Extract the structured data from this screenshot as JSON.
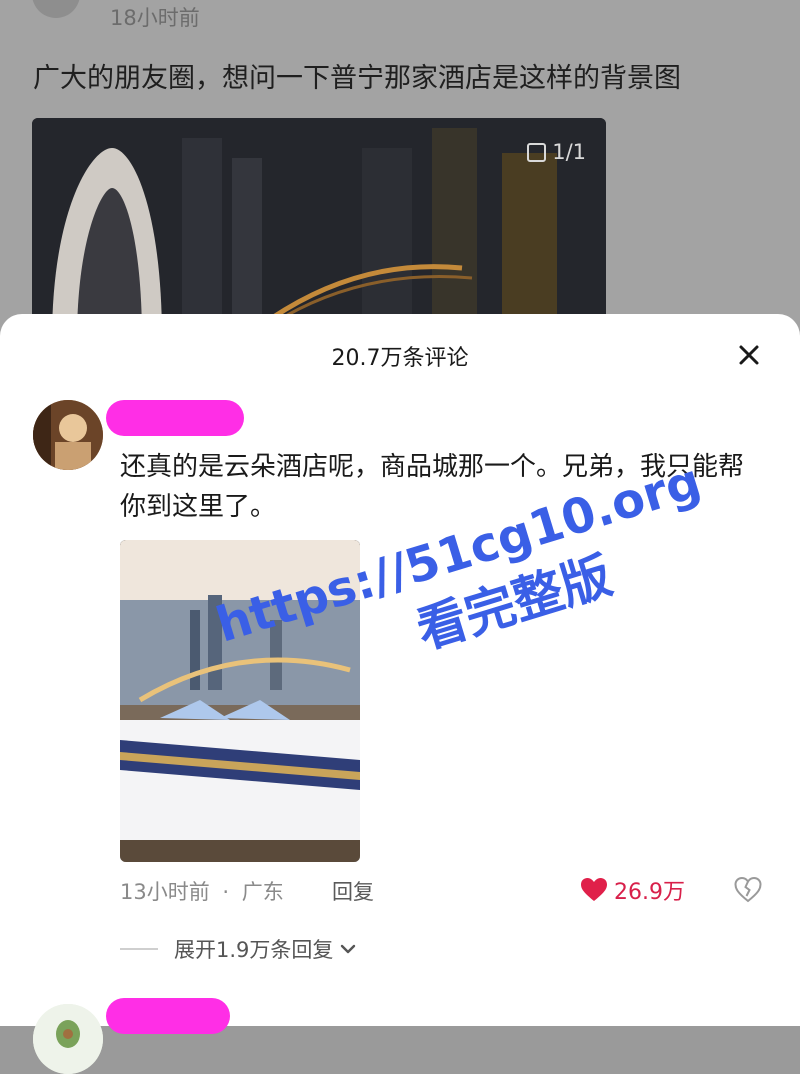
{
  "background_post": {
    "time": "18小时前",
    "text": "广大的朋友圈，想问一下普宁那家酒店是这样的背景图",
    "image_counter": "1/1"
  },
  "comments_sheet": {
    "title": "20.7万条评论",
    "close_icon": "close-icon",
    "comment": {
      "text": "还真的是云朵酒店呢，商品城那一个。兄弟，我只能帮你到这里了。",
      "time": "13小时前",
      "separator": "·",
      "location": "广东",
      "reply_label": "回复",
      "like_icon": "heart-filled-icon",
      "like_count": "26.9万",
      "dislike_icon": "broken-heart-icon",
      "expand_label": "展开1.9万条回复",
      "expand_icon": "chevron-down-icon"
    }
  },
  "watermark": {
    "line1": "https://51cg10.org",
    "line2": "看完整版"
  },
  "colors": {
    "like": "#e0204a",
    "name_redaction": "#ff2ee6",
    "watermark": "#3a5fe6"
  }
}
